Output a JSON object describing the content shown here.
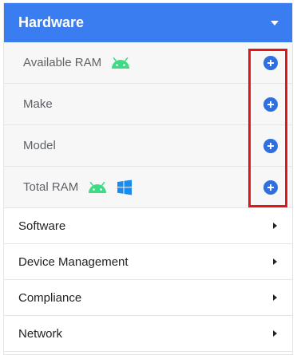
{
  "header": {
    "title": "Hardware",
    "icon": "caret-down-icon",
    "color": "#3a7df0"
  },
  "subitems": [
    {
      "label": "Available RAM",
      "icons": [
        "android-icon"
      ]
    },
    {
      "label": "Make",
      "icons": []
    },
    {
      "label": "Model",
      "icons": []
    },
    {
      "label": "Total RAM",
      "icons": [
        "android-icon",
        "windows-icon"
      ]
    }
  ],
  "categories": [
    {
      "label": "Software"
    },
    {
      "label": "Device Management"
    },
    {
      "label": "Compliance"
    },
    {
      "label": "Network"
    }
  ],
  "colors": {
    "accent": "#3a7df0",
    "add_button": "#2f6fe0",
    "android": "#3ddc84",
    "windows": "#1a8cf0",
    "highlight": "#e3151a"
  }
}
